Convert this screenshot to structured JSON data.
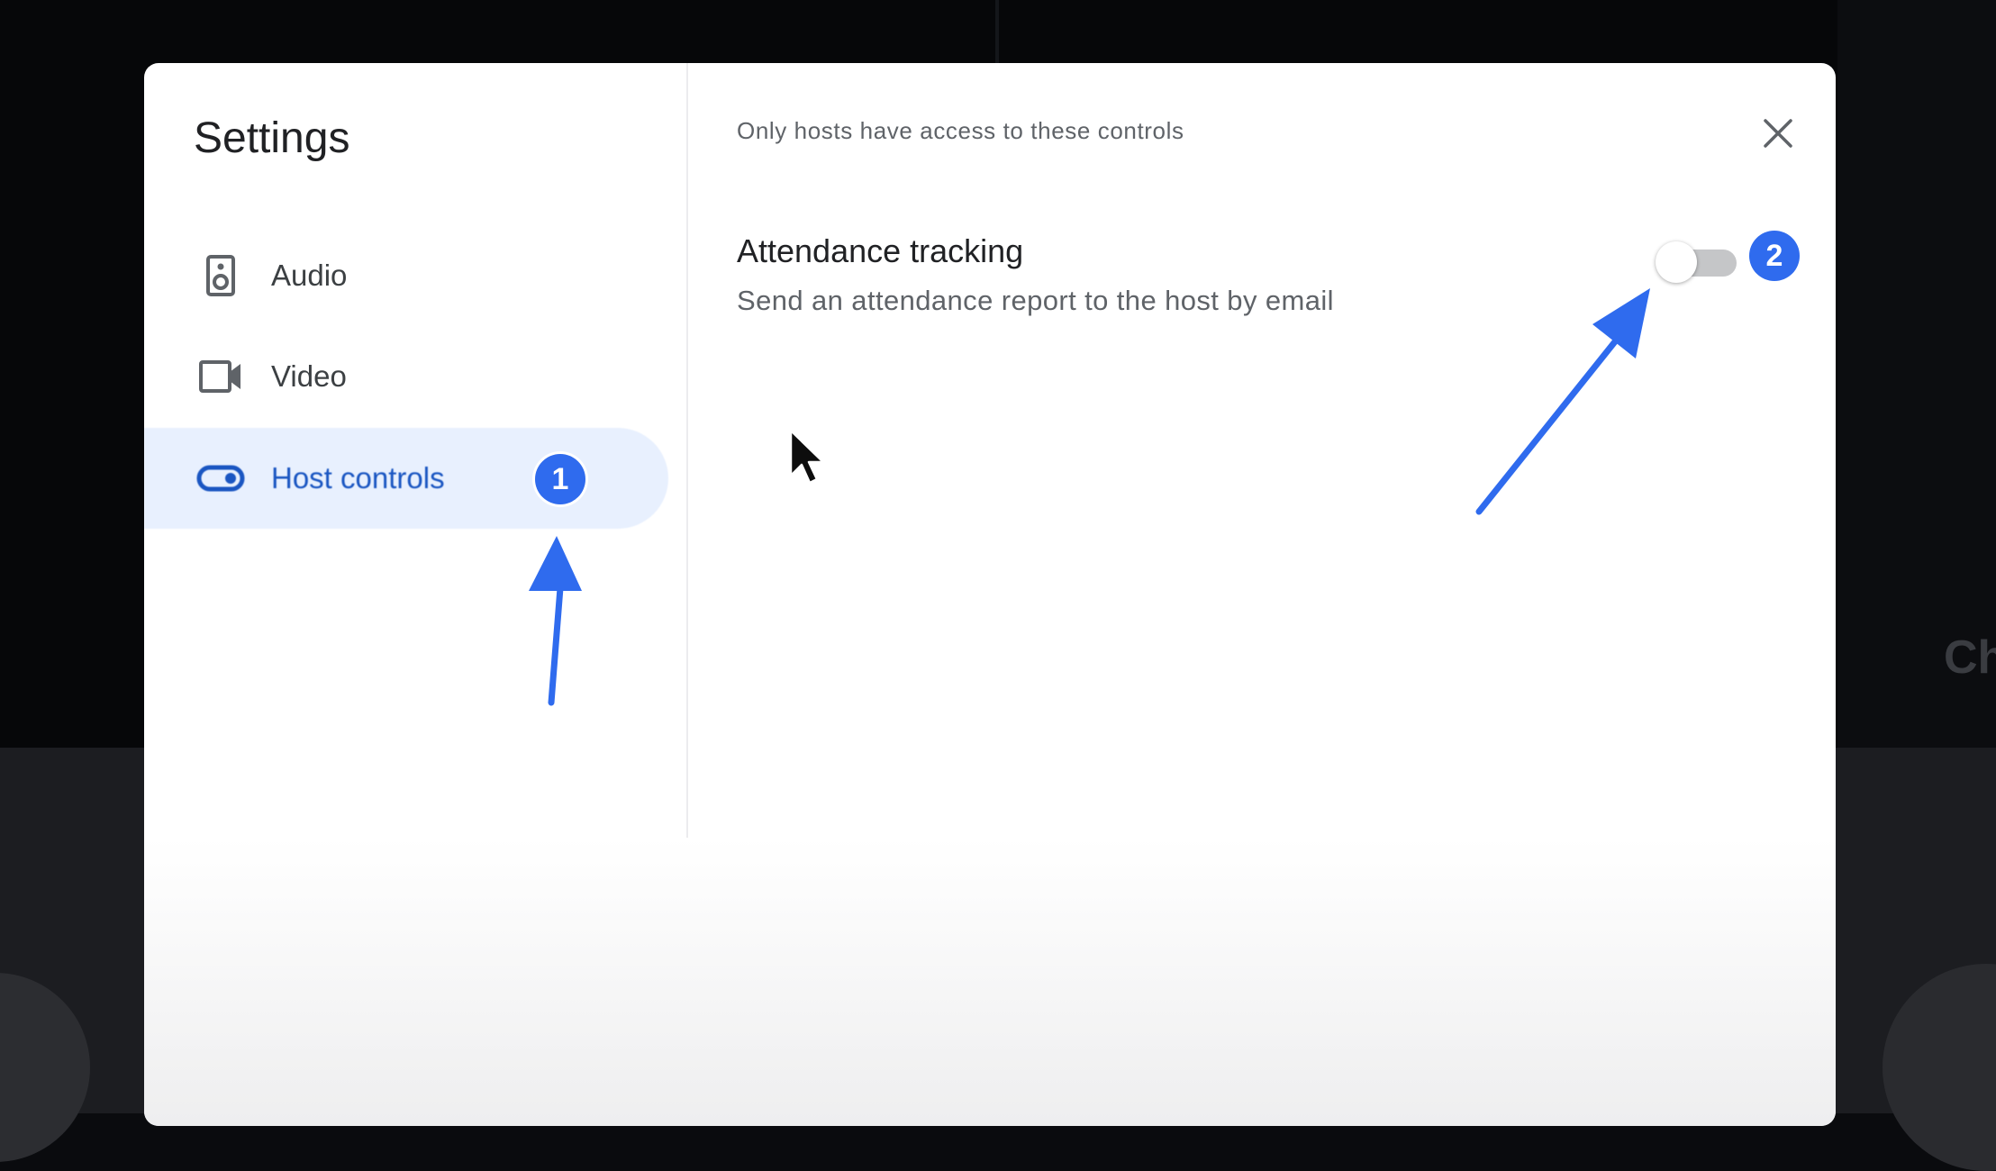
{
  "dialog": {
    "title": "Settings",
    "close_icon": "close-icon"
  },
  "sidebar": {
    "items": [
      {
        "label": "Audio",
        "icon": "speaker-icon",
        "active": false
      },
      {
        "label": "Video",
        "icon": "videocam-icon",
        "active": false
      },
      {
        "label": "Host controls",
        "icon": "toggle-icon",
        "active": true
      }
    ]
  },
  "main": {
    "hint": "Only hosts have access to these controls",
    "setting": {
      "title": "Attendance tracking",
      "description": "Send an attendance report to the host by email",
      "enabled": false
    }
  },
  "annotations": {
    "badge1": "1",
    "badge2": "2"
  },
  "background": {
    "partial_text": "Ch"
  },
  "colors": {
    "accent_blue": "#2f6bee",
    "active_nav_bg": "#e8f0fe",
    "active_nav_text": "#1a56c2"
  }
}
